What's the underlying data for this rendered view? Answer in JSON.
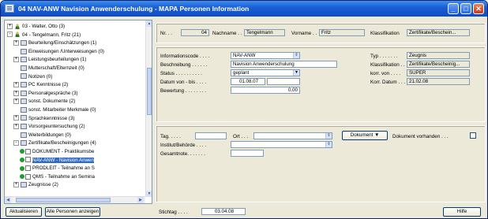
{
  "window": {
    "title": "04 NAV-ANW  Navision Anwenderschulung - MAPA Personen Information"
  },
  "tree": {
    "items": [
      {
        "label": "03 - Walter, Otto (3)",
        "expander": "+",
        "icon": "person",
        "indent": 0
      },
      {
        "label": "04 - Tengelmann, Fritz (21)",
        "expander": "-",
        "icon": "person",
        "indent": 0
      },
      {
        "label": "Beurteilung/Einschätzungen (1)",
        "expander": "+",
        "icon": "folder",
        "indent": 1
      },
      {
        "label": "Einweisungen /Unterweisungen (0)",
        "expander": "",
        "icon": "folder",
        "indent": 1
      },
      {
        "label": "Leistungsbeurteilungen (1)",
        "expander": "+",
        "icon": "folder",
        "indent": 1
      },
      {
        "label": "Mutterschaft/Elternzeit (0)",
        "expander": "",
        "icon": "folder",
        "indent": 1
      },
      {
        "label": "Notizen (0)",
        "expander": "",
        "icon": "folder",
        "indent": 1
      },
      {
        "label": "PC Kenntnisse (2)",
        "expander": "+",
        "icon": "folder",
        "indent": 1
      },
      {
        "label": "Personalgespräche (3)",
        "expander": "+",
        "icon": "folder",
        "indent": 1
      },
      {
        "label": "sonst. Dokumente (2)",
        "expander": "+",
        "icon": "folder",
        "indent": 1
      },
      {
        "label": "sonst. Mitarbeiter Merkmale (0)",
        "expander": "",
        "icon": "folder",
        "indent": 1
      },
      {
        "label": "Sprachkenntnisse (3)",
        "expander": "+",
        "icon": "folder",
        "indent": 1
      },
      {
        "label": "Vorsorgeuntersuchung (2)",
        "expander": "+",
        "icon": "folder",
        "indent": 1
      },
      {
        "label": "Weiterbildungen (0)",
        "expander": "",
        "icon": "folder",
        "indent": 1
      },
      {
        "label": "Zertifikate/Bescheinigungen (4)",
        "expander": "-",
        "icon": "folder",
        "indent": 1
      },
      {
        "label": "DOKUMENT - Praktikumsbe",
        "expander": "",
        "icon": "doc",
        "indent": 2
      },
      {
        "label": "NAV-ANW - Navision Anwen",
        "expander": "",
        "icon": "doc",
        "indent": 2,
        "selected": true
      },
      {
        "label": "PRODLEIT - Teilnahme an S",
        "expander": "",
        "icon": "doc",
        "indent": 2
      },
      {
        "label": "QMS - Teilnahme an Semina",
        "expander": "",
        "icon": "doc",
        "indent": 2
      },
      {
        "label": "Zeugnisse (2)",
        "expander": "+",
        "icon": "folder",
        "indent": 1
      }
    ]
  },
  "header": {
    "nr_label": "Nr. . .",
    "nr_value": "04",
    "nachname_label": "Nachname . .",
    "nachname_value": "Tengelmann",
    "vorname_label": "Vorname . .",
    "vorname_value": "Fritz",
    "klass_label": "Klassifikation",
    "klass_value": "Zertifikate/Beschein..."
  },
  "info": {
    "infocode_label": "Informationscode . . . .",
    "infocode_value": "NAV-ANW",
    "beschr_label": "Beschreibung . . . . . .",
    "beschr_value": "Navision Anwenderschulung",
    "status_label": "Status . . . . . . . . . .",
    "status_value": "geplant",
    "datum_label": "Datum von - bis . . . .",
    "datum_von": "01.08.07",
    "datum_bis": "",
    "bewertung_label": "Bewertung . . . . . . . .",
    "bewertung_value": "0,00",
    "typ_label": "Typ . . . . . . .",
    "typ_value": "Zeugnis",
    "klass2_label": "Klassifikation . .",
    "klass2_value": "Zertifikate/Bescheinig...",
    "korrvon_label": "korr. von . . . .",
    "korrvon_value": "SUPER",
    "korrdatum_label": "Korr. Datum . . .",
    "korrdatum_value": "21.02.08"
  },
  "extra": {
    "tag_label": "Tag. . . . .",
    "tag_value": "",
    "ort_label": "Ort . . .",
    "ort_value": "",
    "institut_label": "Institut/Behörde . . . .",
    "institut_value": "",
    "gesamtnote_label": "Gesamtnote. . . . . . .",
    "gesamtnote_value": "",
    "dokument_button": "Dokument",
    "dok_vorhanden_label": "Dokument vorhanden . . ."
  },
  "footer": {
    "aktualisieren": "Aktualisieren",
    "alle_personen": "Alle Personen anzeigen",
    "stichtag_label": "Stichtag . . . .",
    "stichtag_value": "03.04.08",
    "hilfe": "Hilfe"
  },
  "colors": {
    "titlebar": "#1A5FD6",
    "selection": "#316AC5",
    "window_bg": "#ECE9D8"
  }
}
